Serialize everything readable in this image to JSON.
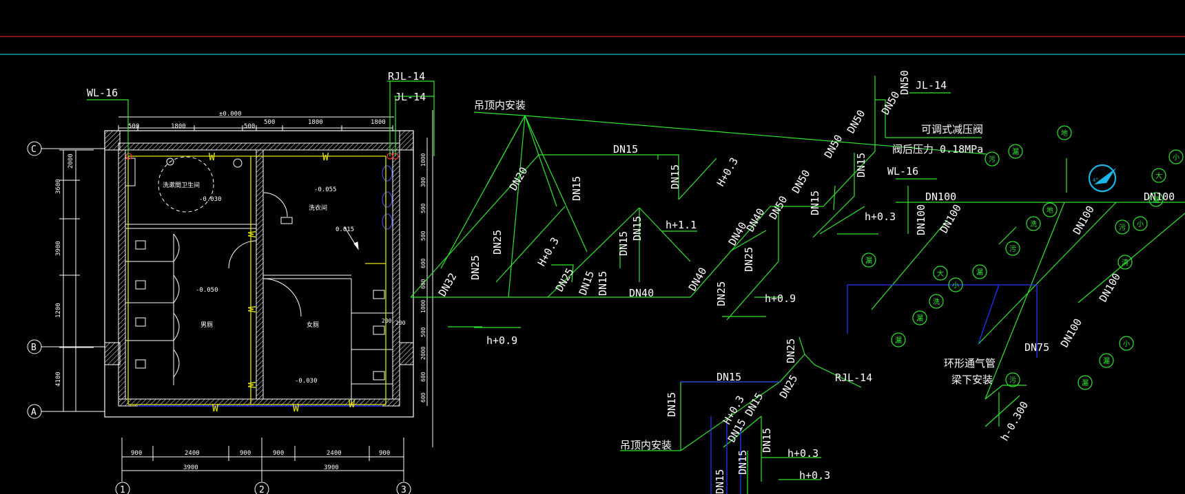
{
  "colors": {
    "background": "#000000",
    "pipe_green": "#2ee82e",
    "wall_white": "#ffffff",
    "water_yellow": "#e8e800",
    "vent_blue": "#2233ff",
    "guide_red": "#cc2222",
    "guide_cyan": "#00c8c8",
    "compass_cyan": "#19b6e6"
  },
  "plan": {
    "riser_wl": "WL-16",
    "riser_rjl": "RJL-14",
    "riser_jl": "JL-14",
    "axis_labels": [
      "C",
      "B",
      "A",
      "1",
      "2",
      "3"
    ],
    "room_labels": [
      "洗漱間卫生间",
      "洗衣间",
      "男厕",
      "女厕"
    ],
    "elevations": [
      "±0.000",
      "-0.030",
      "-0.055",
      "-0.050",
      "-0.030",
      "-0.030"
    ],
    "slope": "0.015",
    "pipe_marks": [
      "W",
      "W",
      "W",
      "W",
      "W",
      "W",
      "W",
      "W"
    ],
    "top_dims": [
      "500",
      "1800",
      "500",
      "500",
      "1800",
      "1800"
    ],
    "bottom_dims": [
      "900",
      "2400",
      "900",
      "900",
      "2400",
      "900"
    ],
    "bottom_totals": [
      "3900",
      "3900"
    ],
    "left_dims": [
      "3600",
      "2000",
      "3900",
      "1200",
      "4100"
    ],
    "right_dims": [
      "1000",
      "300",
      "500",
      "500",
      "600",
      "600",
      "1000",
      "500",
      "2000",
      "600",
      "600"
    ],
    "extra_dims": [
      "200",
      "200"
    ]
  },
  "water_iso": {
    "note_ceiling": "吊顶内安装",
    "pipe_sizes": [
      "DN15",
      "DN15",
      "DN15",
      "DN15",
      "DN15",
      "DN15",
      "DN15",
      "DN20",
      "DN25",
      "DN25",
      "DN25",
      "DN25",
      "DN25",
      "DN32",
      "DN40",
      "DN40",
      "DN40",
      "DN40",
      "DN50",
      "DN50",
      "DN50",
      "DN50",
      "DN50",
      "DN50",
      "DN15"
    ],
    "heights": [
      "h+0.9",
      "h+0.3",
      "h+0.3",
      "h+1.1",
      "h+0.9",
      "h+0.3",
      "H+0.3"
    ],
    "riser": "JL-14",
    "valve_label": "可调式减压阀",
    "valve_pressure": "阀后压力  0.18MPa"
  },
  "hot_iso": {
    "riser": "RJL-14",
    "note_ceiling": "吊顶内安装",
    "pipe_sizes": [
      "DN25",
      "DN25",
      "DN15",
      "DN15",
      "DN15",
      "DN15",
      "DN15",
      "DN15",
      "DN15",
      "DN15"
    ],
    "heights": [
      "H+0.3",
      "h+0.3",
      "h+0.3"
    ]
  },
  "drain_iso": {
    "riser": "WL-16",
    "pipe_sizes": [
      "DN100",
      "DN100",
      "DN100",
      "DN100",
      "DN100",
      "DN100",
      "DN100",
      "DN75"
    ],
    "vent_note": "环形通气管",
    "vent_note2": "梁下安装",
    "height": "h-0.300",
    "fixture_tags": [
      "地",
      "污",
      "漏",
      "大",
      "小",
      "漏",
      "小",
      "污",
      "洗",
      "地",
      "污",
      "漏",
      "大",
      "小",
      "漏",
      "洗",
      "漏",
      "漏",
      "清",
      "小",
      "漏",
      "污",
      "漏"
    ],
    "compass": "4°"
  }
}
